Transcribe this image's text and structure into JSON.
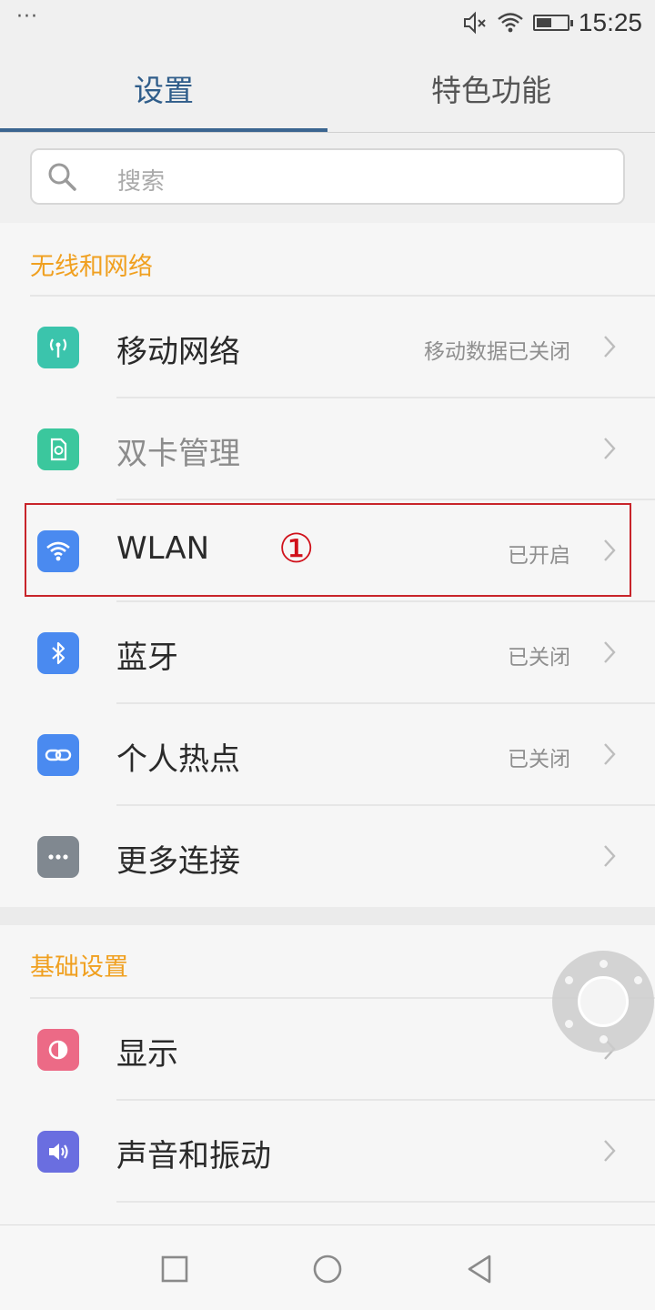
{
  "status_bar": {
    "notification_dots": "···",
    "time": "15:25",
    "icons": [
      "mute-icon",
      "wifi-icon",
      "battery-icon"
    ],
    "battery_level": 0.5
  },
  "tabs": [
    {
      "label": "设置",
      "active": true
    },
    {
      "label": "特色功能",
      "active": false
    }
  ],
  "search": {
    "placeholder": "搜索"
  },
  "sections": [
    {
      "title": "无线和网络",
      "items": [
        {
          "label": "移动网络",
          "status": "移动数据已关闭",
          "icon": "cellular-icon",
          "color": "#3bc4ac"
        },
        {
          "label": "双卡管理",
          "status": "",
          "icon": "sim-icon",
          "color": "#3bc79d",
          "muted": true
        },
        {
          "label": "WLAN",
          "status": "已开启",
          "icon": "wifi-icon",
          "color": "#4a8af0"
        },
        {
          "label": "蓝牙",
          "status": "已关闭",
          "icon": "bluetooth-icon",
          "color": "#4a8af0"
        },
        {
          "label": "个人热点",
          "status": "已关闭",
          "icon": "hotspot-icon",
          "color": "#4a8af0"
        },
        {
          "label": "更多连接",
          "status": "",
          "icon": "more-icon",
          "color": "#808890"
        }
      ]
    },
    {
      "title": "基础设置",
      "items": [
        {
          "label": "显示",
          "status": "",
          "icon": "display-icon",
          "color": "#ec6a86"
        },
        {
          "label": "声音和振动",
          "status": "",
          "icon": "sound-icon",
          "color": "#6a6ee0"
        }
      ]
    }
  ],
  "annotation": "①",
  "colors": {
    "accent": "#3b6590",
    "section_title": "#f0a020",
    "highlight": "#c8242a"
  },
  "nav": [
    "recent-apps-button",
    "home-button",
    "back-button"
  ]
}
